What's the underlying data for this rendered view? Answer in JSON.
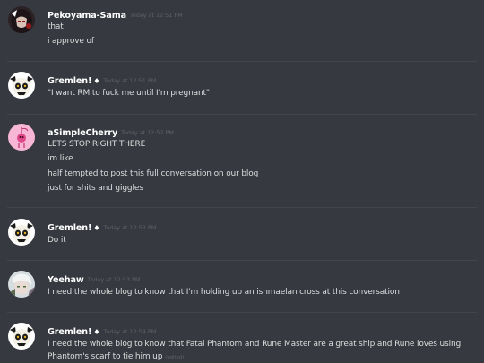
{
  "messages": [
    {
      "username": "Pekoyama-Sama",
      "has_badge": false,
      "timestamp": "Today at 12:51 PM",
      "avatar": "dark-anime-avatar-icon",
      "lines": [
        "that",
        "i approve of"
      ]
    },
    {
      "username": "Gremlen!",
      "badge": "♦",
      "timestamp": "Today at 12:51 PM",
      "avatar": "skull-mask-avatar-icon",
      "lines": [
        "\"I want RM to fuck me until I'm pregnant\""
      ]
    },
    {
      "username": "aSimpleCherry",
      "has_badge": false,
      "timestamp": "Today at 12:52 PM",
      "avatar": "pink-cherry-avatar-icon",
      "lines": [
        "LETS STOP RIGHT THERE",
        "im like",
        "half tempted to post this full conversation on our blog",
        "just for shits and giggles"
      ]
    },
    {
      "username": "Gremlen!",
      "badge": "♦",
      "timestamp": "Today at 12:53 PM",
      "avatar": "skull-mask-avatar-icon",
      "lines": [
        "Do it"
      ]
    },
    {
      "username": "Yeehaw",
      "has_badge": false,
      "timestamp": "Today at 12:53 PM",
      "avatar": "pale-character-avatar-icon",
      "lines": [
        "I need the whole blog to know that I'm holding up an ishmaelan cross at this conversation"
      ]
    },
    {
      "username": "Gremlen!",
      "badge": "♦",
      "timestamp": "Today at 12:54 PM",
      "avatar": "skull-mask-avatar-icon",
      "lines": [
        "I need the whole blog to know that Fatal Phantom and Rune Master are a great ship and Rune loves using",
        "Phantom's scarf to tie him up"
      ],
      "edited": "(edited)"
    }
  ]
}
